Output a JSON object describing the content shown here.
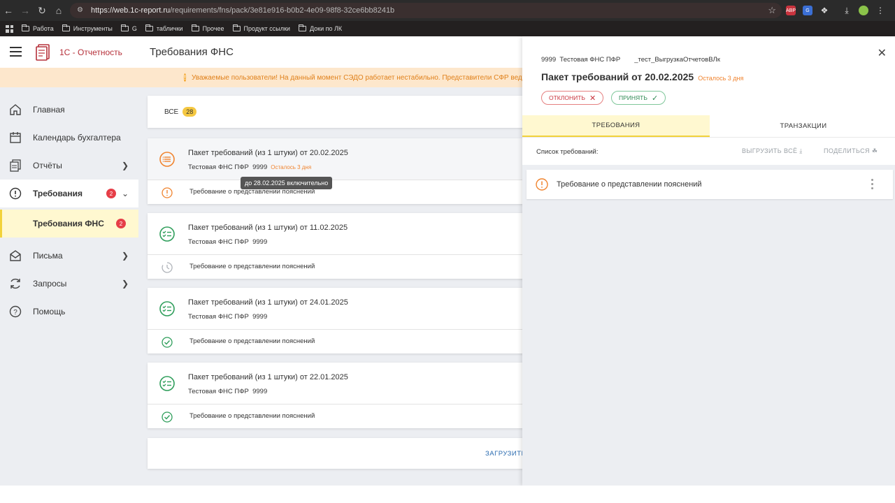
{
  "browser": {
    "url_host": "https://web.1c-report.ru",
    "url_path": "/requirements/fns/pack/3e81e916-b0b2-4e09-98f8-32ce6bb8241b",
    "bookmarks": [
      "Работа",
      "Инструменты",
      "G",
      "таблички",
      "Прочее",
      "Продукт ссылки",
      "Доки по ЛК"
    ]
  },
  "app": {
    "logo_text": "1С - Отчетность",
    "page_title": "Требования ФНС",
    "banner": "Уважаемые пользователи! На данный момент СЭДО работает нестабильно. Представители СФР ведут р"
  },
  "sidebar": {
    "items": [
      {
        "label": "Главная",
        "icon": "home-icon"
      },
      {
        "label": "Календарь бухгалтера",
        "icon": "calendar-icon"
      },
      {
        "label": "Отчёты",
        "icon": "reports-icon"
      },
      {
        "label": "Требования",
        "icon": "alert-circle-icon",
        "badge": "2"
      },
      {
        "label": "Требования ФНС",
        "badge": "2"
      },
      {
        "label": "Письма",
        "icon": "mail-icon"
      },
      {
        "label": "Запросы",
        "icon": "refresh-icon"
      },
      {
        "label": "Помощь",
        "icon": "help-icon"
      }
    ]
  },
  "content": {
    "all_label": "ВСЕ",
    "all_count": "28",
    "packs": [
      {
        "title": "Пакет требований (из 1 штуки) от 20.02.2025",
        "sender": "Тестовая ФНС ПФР",
        "code": "9999",
        "remaining": "Осталось 3 дня",
        "req": "Требование о представлении пояснений",
        "status": "warning"
      },
      {
        "title": "Пакет требований (из 1 штуки) от 11.02.2025",
        "sender": "Тестовая ФНС ПФР",
        "code": "9999",
        "remaining": "",
        "req": "Требование о представлении пояснений",
        "status": "pending"
      },
      {
        "title": "Пакет требований (из 1 штуки) от 24.01.2025",
        "sender": "Тестовая ФНС ПФР",
        "code": "9999",
        "remaining": "",
        "req": "Требование о представлении пояснений",
        "status": "done"
      },
      {
        "title": "Пакет требований (из 1 штуки) от 22.01.2025",
        "sender": "Тестовая ФНС ПФР",
        "code": "9999",
        "remaining": "",
        "req": "Требование о представлении пояснений",
        "status": "done"
      }
    ],
    "tooltip": "до 28.02.2025 включительно",
    "load_more": "ЗАГРУЗИТЬ"
  },
  "panel": {
    "code": "9999",
    "sender": "Тестовая ФНС ПФР",
    "org": "_тест_ВыгрузкаОтчетовВЛк",
    "title": "Пакет требований от 20.02.2025",
    "remaining": "Осталось 3 дня",
    "reject_label": "ОТКЛОНИТЬ",
    "accept_label": "ПРИНЯТЬ",
    "tabs": [
      "ТРЕБОВАНИЯ",
      "ТРАНЗАКЦИИ"
    ],
    "list_label": "Список требований:",
    "export_all": "ВЫГРУЗИТЬ ВСЁ",
    "share": "ПОДЕЛИТЬСЯ",
    "requirement": "Требование о представлении пояснений"
  },
  "colors": {
    "accent_red": "#b6303a",
    "warning_orange": "#f0842f",
    "success_green": "#2f9e5b",
    "active_yellow": "#f2d23a",
    "link_blue": "#2a6bb0"
  }
}
